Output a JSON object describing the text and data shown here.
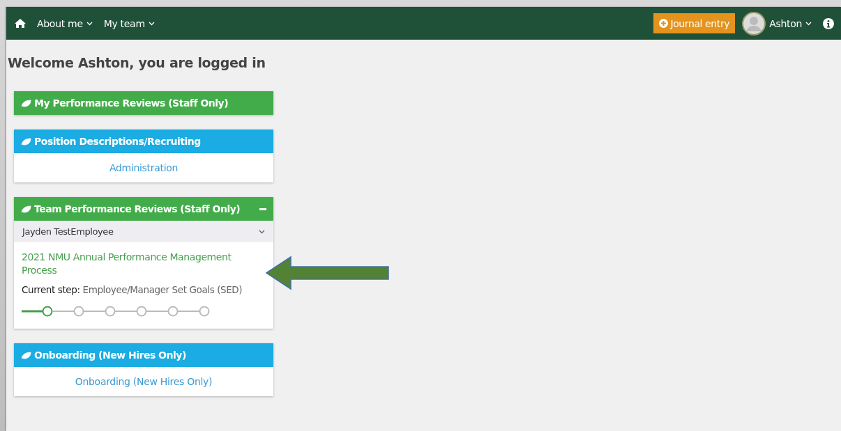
{
  "navbar": {
    "menus": [
      {
        "label": "About me"
      },
      {
        "label": "My team"
      }
    ],
    "journal_button": "Journal entry",
    "user": "Ashton"
  },
  "welcome": "Welcome Ashton, you are logged in",
  "panels": [
    {
      "kind": "plain",
      "title": "My Performance Reviews (Staff Only)",
      "color": "#43ac4a"
    },
    {
      "kind": "links",
      "title": "Position Descriptions/Recruiting",
      "color": "#1aace2",
      "links": [
        "Administration"
      ]
    },
    {
      "kind": "review",
      "title": "Team Performance Reviews (Staff Only)",
      "color": "#43ac4a",
      "collapsible": true,
      "employee": "Jayden TestEmployee",
      "process": "2021 NMU Annual Performance Management Process",
      "step_label": "Current step:",
      "step_value": "Employee/Manager Set Goals (SED)",
      "steps": [
        {
          "selected": true
        },
        {
          "selected": false
        },
        {
          "selected": false
        },
        {
          "selected": false
        },
        {
          "selected": false
        },
        {
          "selected": false
        }
      ]
    },
    {
      "kind": "links",
      "title": "Onboarding (New Hires Only)",
      "color": "#1aace2",
      "links": [
        "Onboarding (New Hires Only)"
      ]
    }
  ]
}
